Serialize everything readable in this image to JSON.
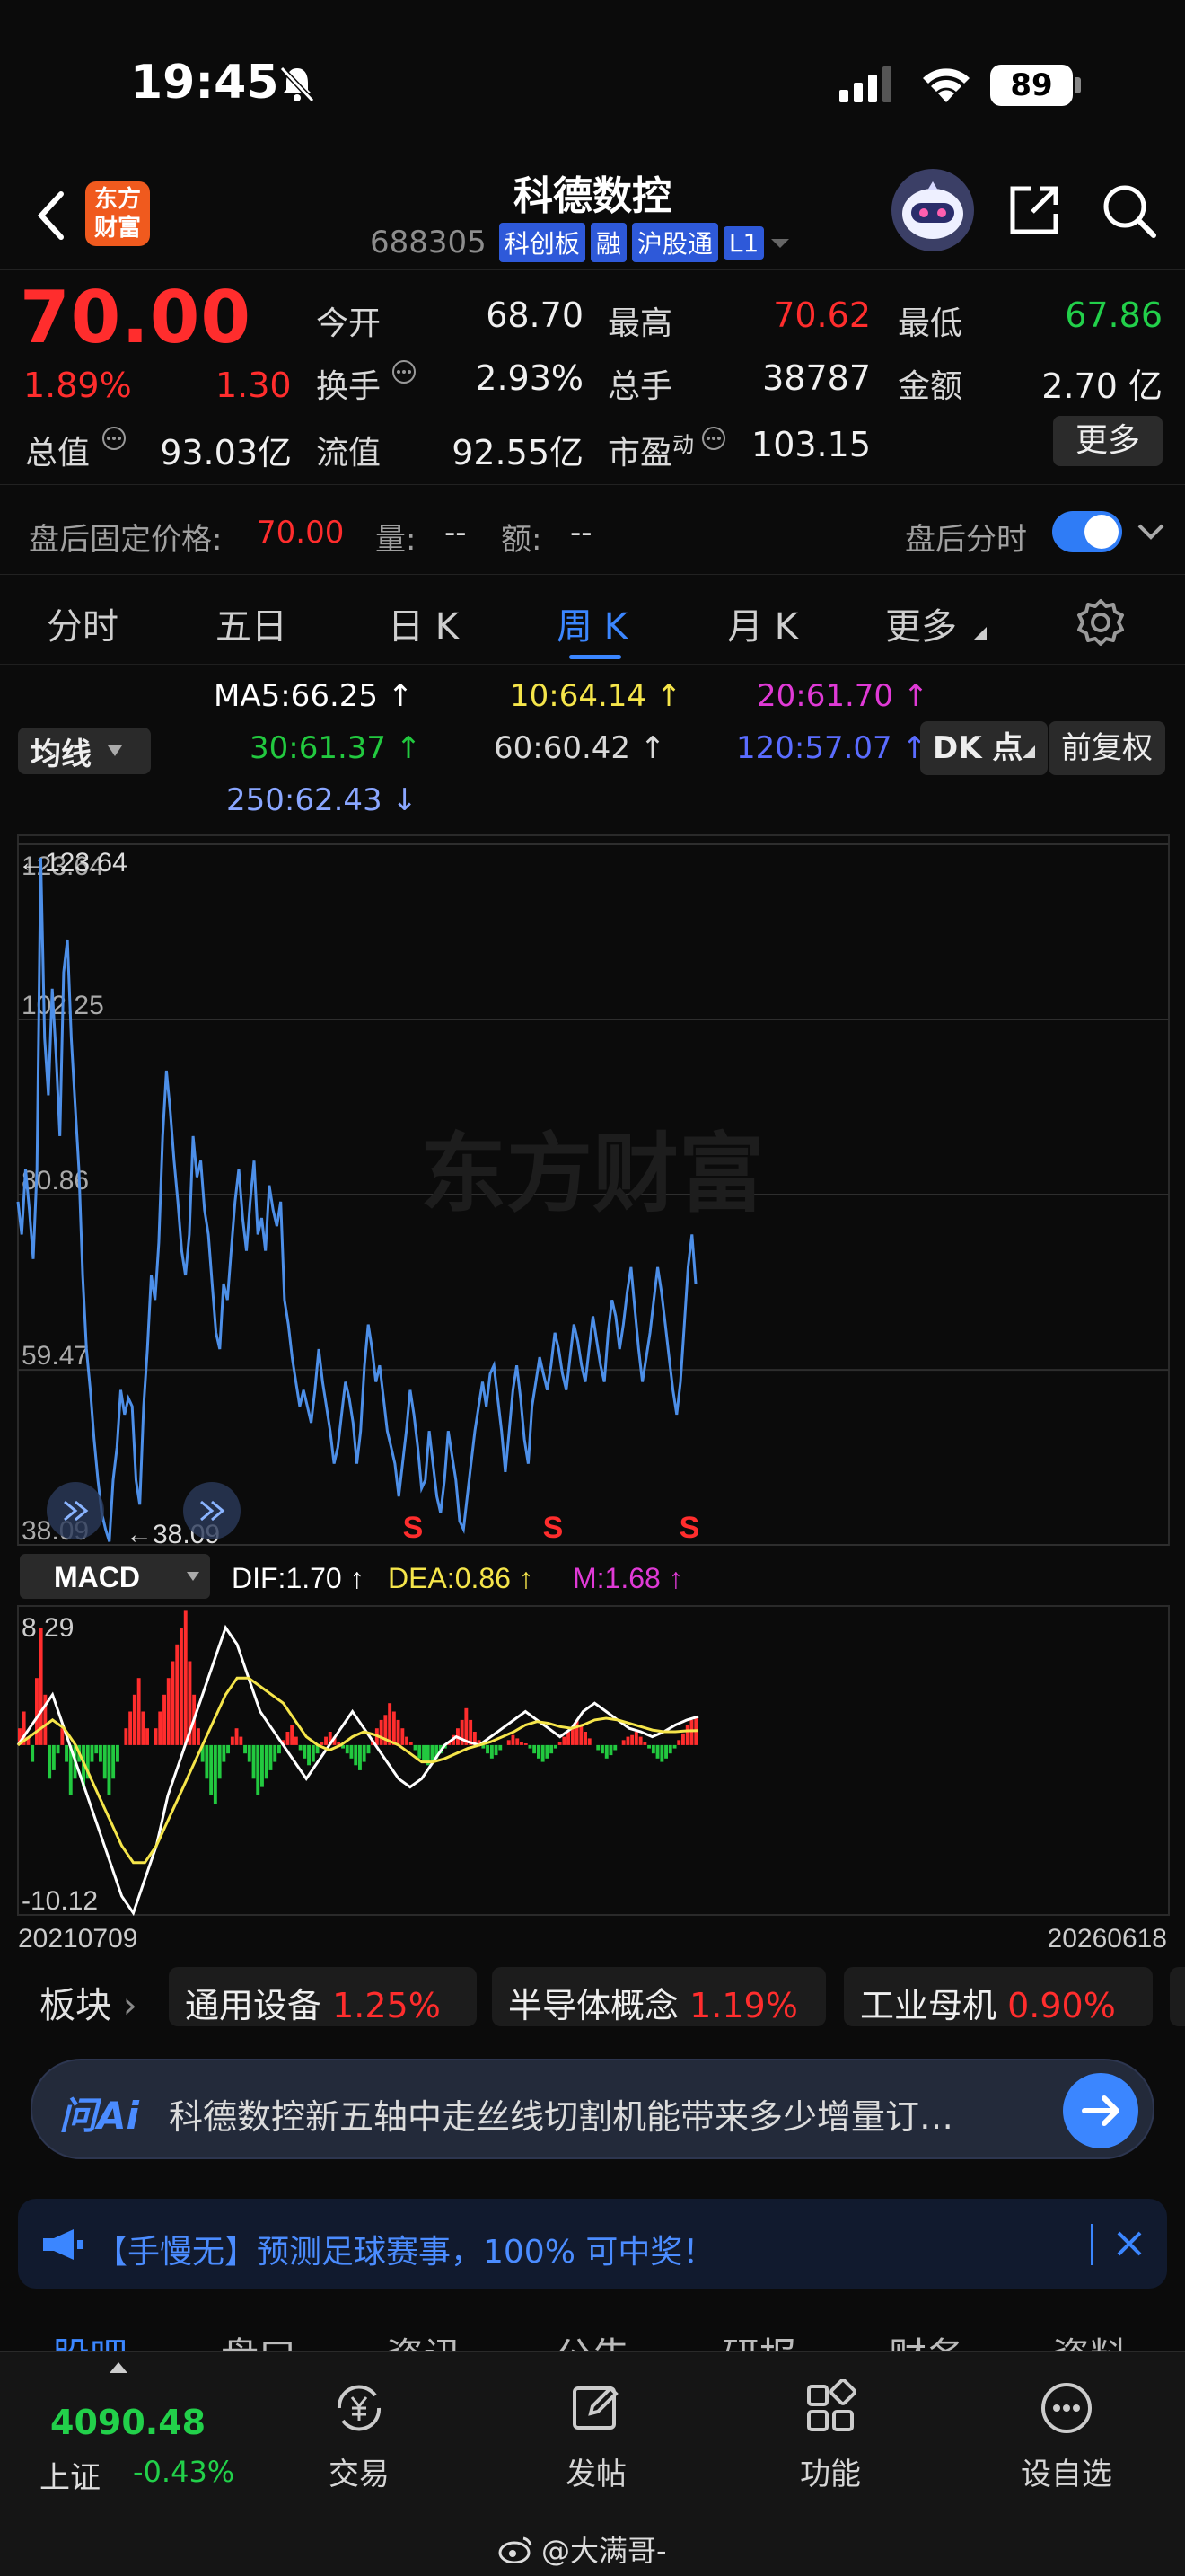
{
  "status": {
    "time": "19:45",
    "battery": "89"
  },
  "header": {
    "back_icon": "chevron-left-icon",
    "logo_text": "东方\n财富",
    "stock_name": "科德数控",
    "code": "688305",
    "badges": [
      "科创板",
      "融",
      "沪股通",
      "L1"
    ],
    "icons": [
      "robot-avatar-icon",
      "share-icon",
      "search-icon"
    ]
  },
  "quote": {
    "price": "70.00",
    "change_pct": "1.89%",
    "change": "1.30",
    "stats": [
      {
        "label": "今开",
        "value": "68.70"
      },
      {
        "label": "最高",
        "value": "70.62"
      },
      {
        "label": "最低",
        "value": "67.86"
      },
      {
        "label": "换手",
        "value": "2.93%"
      },
      {
        "label": "总手",
        "value": "38787"
      },
      {
        "label": "金额",
        "value": "2.70 亿"
      },
      {
        "label": "总值",
        "value": "93.03亿"
      },
      {
        "label": "流值",
        "value": "92.55亿"
      },
      {
        "label": "市盈",
        "label_sup": "动",
        "value": "103.15"
      }
    ],
    "more_button": "更多"
  },
  "after_hours": {
    "label": "盘后固定价格:",
    "price": "70.00",
    "vol_label": "量:",
    "vol": "--",
    "amt_label": "额:",
    "amt": "--",
    "toggle_label": "盘后分时",
    "toggle_on": true
  },
  "tabs": {
    "items": [
      "分时",
      "五日",
      "日 K",
      "周 K",
      "月 K",
      "更多"
    ],
    "active": "周 K",
    "settings_icon": "gear-icon"
  },
  "ma": {
    "selector": "均线",
    "dk_button": "DK 点",
    "adjust_button": "前复权",
    "items": [
      {
        "text": "MA5:66.25 ↑",
        "color": "#ffffff"
      },
      {
        "text": "10:64.14 ↑",
        "color": "#f5e54a"
      },
      {
        "text": "20:61.70 ↑",
        "color": "#e03ad6"
      },
      {
        "text": "30:61.37 ↑",
        "color": "#22c93f"
      },
      {
        "text": "60:60.42 ↑",
        "color": "#d8d8d8"
      },
      {
        "text": "120:57.07 ↑",
        "color": "#5a6cff"
      },
      {
        "text": "250:62.43 ↓",
        "color": "#8aa6ff"
      }
    ]
  },
  "chart_data": [
    {
      "type": "line",
      "y_ticks": [
        "123.64",
        "102.25",
        "80.86",
        "59.47",
        "38.09"
      ],
      "ylim": [
        38.09,
        123.64
      ],
      "max_label": "←123.64",
      "min_label": "←38.09",
      "watermark": "东方财富",
      "signals": [
        "S",
        "S",
        "S"
      ],
      "series": [
        {
          "color": "#4d8fe8",
          "values": [
            80,
            76,
            84,
            79,
            73,
            84,
            122,
            100,
            93,
            106,
            98,
            88,
            108,
            112,
            100,
            92,
            84,
            71,
            62,
            57,
            51,
            46,
            42,
            40,
            38.5,
            46,
            50,
            57,
            54,
            56,
            55,
            46,
            43,
            55,
            62,
            71,
            68,
            75,
            88,
            96,
            91,
            85,
            80,
            74,
            71,
            76,
            88,
            83,
            85,
            79,
            76,
            70,
            64,
            62,
            70,
            68,
            74,
            80,
            84,
            78,
            74,
            80,
            85,
            76,
            78,
            74,
            82,
            79,
            77,
            80,
            68,
            65,
            61,
            58,
            55,
            57,
            55,
            53,
            57,
            62,
            58,
            55,
            52,
            48,
            50,
            54,
            58,
            56,
            53,
            48,
            52,
            60,
            65,
            62,
            58,
            60,
            56,
            52,
            50,
            48,
            44,
            48,
            52,
            57,
            54,
            50,
            45,
            46,
            52,
            48,
            44,
            42,
            46,
            52,
            49,
            46,
            41,
            40,
            44,
            48,
            52,
            55,
            58,
            55,
            59,
            60,
            56,
            52,
            47,
            52,
            57,
            60,
            56,
            51,
            48,
            55,
            58,
            61,
            59,
            57,
            60,
            64,
            62,
            59,
            57,
            61,
            65,
            63,
            60,
            58,
            62,
            66,
            63,
            60,
            58,
            64,
            68,
            66,
            62,
            65,
            69,
            72,
            67,
            62,
            58,
            61,
            64,
            68,
            72,
            69,
            65,
            61,
            57,
            54,
            58,
            65,
            72,
            76,
            70
          ]
        }
      ]
    },
    {
      "type": "bar",
      "indicator": "MACD",
      "legend": [
        {
          "text": "DIF:1.70 ↑",
          "color": "#ffffff"
        },
        {
          "text": "DEA:0.86 ↑",
          "color": "#f5e54a"
        },
        {
          "text": "M:1.68 ↑",
          "color": "#e03ad6"
        }
      ],
      "y_ticks": [
        "8.29",
        "-10.12"
      ],
      "ylim": [
        -10.12,
        8.29
      ],
      "x_range": [
        "20210709",
        "20260618"
      ],
      "series": [
        {
          "name": "M",
          "values": [
            1,
            2,
            0.5,
            -1,
            4,
            7,
            3,
            -2,
            -1.5,
            -0.5,
            1,
            -1,
            -3,
            -2,
            -1,
            -2.5,
            -2,
            -1,
            -0.5,
            -1,
            -2,
            -3,
            -2,
            -1,
            0,
            1,
            2,
            3,
            4,
            2,
            1,
            0,
            1,
            2,
            3,
            4,
            5,
            6,
            7,
            8,
            5,
            3,
            1,
            -1,
            -2,
            -3,
            -3.5,
            -2,
            -1,
            -0.5,
            0.5,
            1,
            0.5,
            -0.5,
            -1,
            -2,
            -3,
            -2.5,
            -2,
            -1.5,
            -1,
            -0.5,
            0.3,
            0.8,
            1.2,
            0.5,
            -0.3,
            -0.8,
            -1.2,
            -1,
            -0.5,
            0.2,
            0.5,
            0.8,
            0.5,
            0.2,
            -0.2,
            -0.5,
            -0.8,
            -1.2,
            -1.5,
            -1,
            -0.5,
            0.3,
            1,
            1.5,
            1.8,
            2.5,
            2,
            1.5,
            1,
            0.5,
            0.2,
            -0.3,
            -0.8,
            -1,
            -1.2,
            -1,
            -0.8,
            -0.5,
            -0.2,
            0.2,
            0.6,
            1,
            1.5,
            2.2,
            1.5,
            0.8,
            0.3,
            -0.2,
            -0.5,
            -0.8,
            -0.6,
            -0.3,
            0,
            0.3,
            0.6,
            0.4,
            0.2,
            0.1,
            -0.2,
            -0.5,
            -0.8,
            -1,
            -0.8,
            -0.5,
            -0.2,
            0.2,
            0.5,
            0.8,
            1,
            1.5,
            1.2,
            0.8,
            0.4,
            0,
            -0.3,
            -0.5,
            -0.8,
            -0.6,
            -0.3,
            0,
            0.3,
            0.5,
            0.6,
            0.8,
            0.5,
            0.2,
            -0.2,
            -0.5,
            -0.8,
            -1,
            -0.8,
            -0.5,
            -0.2,
            0.3,
            0.7,
            1.2,
            1.5,
            1.7
          ]
        },
        {
          "name": "DIF",
          "values": [
            0,
            1,
            2,
            3,
            1,
            -1,
            -3,
            -5,
            -7,
            -9,
            -10,
            -8,
            -6,
            -3,
            -1,
            1,
            3,
            5,
            7,
            6,
            4,
            2,
            1,
            0,
            -1,
            -2,
            -1,
            0,
            1,
            2,
            1,
            0,
            -1,
            -2,
            -2.5,
            -2,
            -1,
            0,
            0.5,
            0.2,
            0,
            0.5,
            1,
            1.5,
            2,
            1.5,
            1,
            0.5,
            1,
            2,
            2.5,
            2,
            1.5,
            1,
            0.8,
            0.5,
            0.8,
            1.2,
            1.5,
            1.7
          ]
        },
        {
          "name": "DEA",
          "values": [
            0,
            0.5,
            1,
            1.5,
            1,
            0,
            -1.5,
            -3,
            -4.5,
            -6,
            -7,
            -7,
            -6,
            -4.5,
            -3,
            -1.5,
            0,
            1.5,
            3,
            4,
            4,
            3.5,
            3,
            2.5,
            1.5,
            0.5,
            0,
            -0.3,
            0,
            0.5,
            0.8,
            0.6,
            0.3,
            0,
            -0.5,
            -1,
            -1,
            -0.8,
            -0.5,
            -0.2,
            0,
            0.2,
            0.5,
            0.8,
            1.2,
            1.4,
            1.3,
            1.1,
            1,
            1.2,
            1.5,
            1.6,
            1.5,
            1.3,
            1.1,
            0.9,
            0.8,
            0.8,
            0.85,
            0.86
          ]
        }
      ]
    }
  ],
  "sectors": {
    "label": "板块",
    "items": [
      {
        "name": "通用设备",
        "pct": "1.25%"
      },
      {
        "name": "半导体概念",
        "pct": "1.19%"
      },
      {
        "name": "工业母机",
        "pct": "0.90%"
      }
    ]
  },
  "ai_bar": {
    "logo": "问Ai",
    "question": "科德数控新五轴中走丝线切割机能带来多少增量订…",
    "send_icon": "arrow-right-icon"
  },
  "promo": {
    "text": "【手慢无】预测足球赛事，100% 可中奖！",
    "megaphone_icon": "megaphone-icon",
    "close_icon": "close-icon"
  },
  "sub_tabs": [
    "股吧",
    "盘口",
    "资讯",
    "公告",
    "研报",
    "财务",
    "资料"
  ],
  "bottom_nav": {
    "index_value": "4090.48",
    "index_name": "上证",
    "index_change": "-0.43%",
    "items": [
      {
        "label": "交易",
        "icon": "yuan-exchange-icon"
      },
      {
        "label": "发帖",
        "icon": "edit-icon"
      },
      {
        "label": "功能",
        "icon": "grid-icon"
      },
      {
        "label": "设自选",
        "icon": "more-dots-icon"
      }
    ]
  },
  "watermark_footer": "@大满哥-"
}
